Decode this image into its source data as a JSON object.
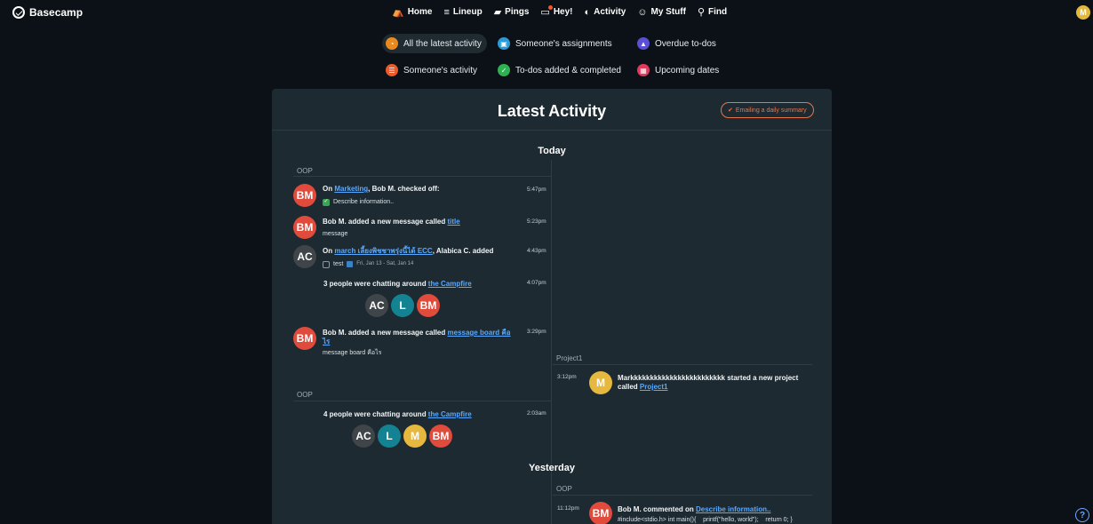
{
  "brand": {
    "name": "Basecamp"
  },
  "nav": {
    "home": "Home",
    "lineup": "Lineup",
    "pings": "Pings",
    "hey": "Hey!",
    "activity": "Activity",
    "my_stuff": "My Stuff",
    "find": "Find"
  },
  "user": {
    "initial": "M",
    "color": "#e4b93b"
  },
  "filters": {
    "latest": "All the latest activity",
    "assignments": "Someone's assignments",
    "overdue": "Overdue to-dos",
    "someones_activity": "Someone's activity",
    "todos": "To-dos added & completed",
    "upcoming": "Upcoming dates"
  },
  "panel": {
    "title": "Latest Activity",
    "email_button": "Emailing a daily summary",
    "today": "Today",
    "yesterday": "Yesterday"
  },
  "left": {
    "group1": "OOP",
    "group2": "OOP",
    "e1": {
      "avatar": "BM",
      "pre": "On ",
      "link": "Marketing",
      "post": ", Bob M. checked off:",
      "sub": "Describe information..",
      "time": "5:47pm"
    },
    "e2": {
      "avatar": "BM",
      "pre": "Bob M. added a new message called ",
      "link": "title",
      "sub": "message",
      "time": "5:23pm"
    },
    "e3": {
      "avatar": "AC",
      "pre": "On ",
      "link": "march เลี้ยงพิชชาพรุ่งนี้ได้ ECC",
      "post": ", Alabica C. added",
      "sub": "test",
      "dates": "Fri, Jan 13 - Sat, Jan 14",
      "time": "4:43pm"
    },
    "e4": {
      "pre": "3 people were chatting around ",
      "link": "the Campfire",
      "time": "4:07pm",
      "avatars": [
        "AC",
        "L",
        "BM"
      ]
    },
    "e5": {
      "avatar": "BM",
      "pre": "Bob M. added a new message called ",
      "link": "message board คือไร",
      "sub": "message board คือไร",
      "time": "3:29pm"
    },
    "e6": {
      "pre": "4 people were chatting around ",
      "link": "the Campfire",
      "time": "2:03am",
      "avatars": [
        "AC",
        "L",
        "M",
        "BM"
      ]
    }
  },
  "right": {
    "group1": "Project1",
    "p1": {
      "time": "3:12pm",
      "avatar": "M",
      "pre": "Markkkkkkkkkkkkkkkkkkkkkkkk started a new project called ",
      "link": "Project1"
    },
    "group2": "OOP",
    "y1": {
      "time": "11:12pm",
      "avatar": "BM",
      "pre": "Bob M. commented on ",
      "link": "Describe information..",
      "sub": "#include<stdio.h> int main(){    printf(\"hello, world\");    return 0; }"
    }
  },
  "help": "?"
}
